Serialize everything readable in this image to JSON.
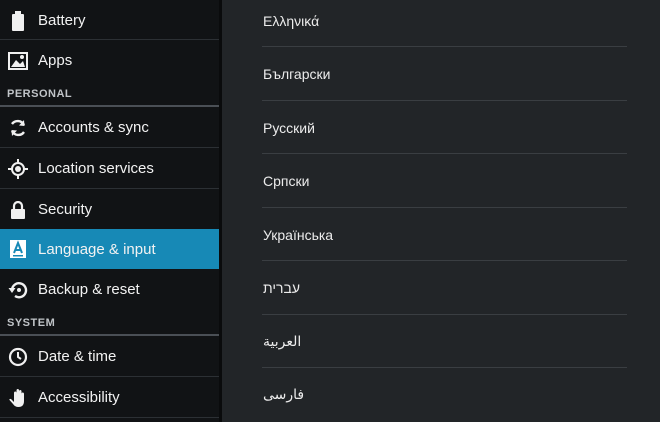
{
  "sidebar": {
    "items_top": [
      {
        "label": "Battery",
        "icon": "battery-icon"
      },
      {
        "label": "Apps",
        "icon": "apps-icon"
      }
    ],
    "personal_header": "PERSONAL",
    "items_personal": [
      {
        "label": "Accounts & sync",
        "icon": "sync-icon"
      },
      {
        "label": "Location services",
        "icon": "location-icon"
      },
      {
        "label": "Security",
        "icon": "lock-icon"
      },
      {
        "label": "Language & input",
        "icon": "language-icon"
      },
      {
        "label": "Backup & reset",
        "icon": "backup-icon"
      }
    ],
    "system_header": "SYSTEM",
    "items_system": [
      {
        "label": "Date & time",
        "icon": "clock-icon"
      },
      {
        "label": "Accessibility",
        "icon": "hand-icon"
      }
    ],
    "selected": "Language & input",
    "accent_color": "#1789b6"
  },
  "languages": [
    "Ελληνικά",
    "Български",
    "Русский",
    "Српски",
    "Українська",
    "עברית",
    "العربية",
    "فارسی"
  ]
}
